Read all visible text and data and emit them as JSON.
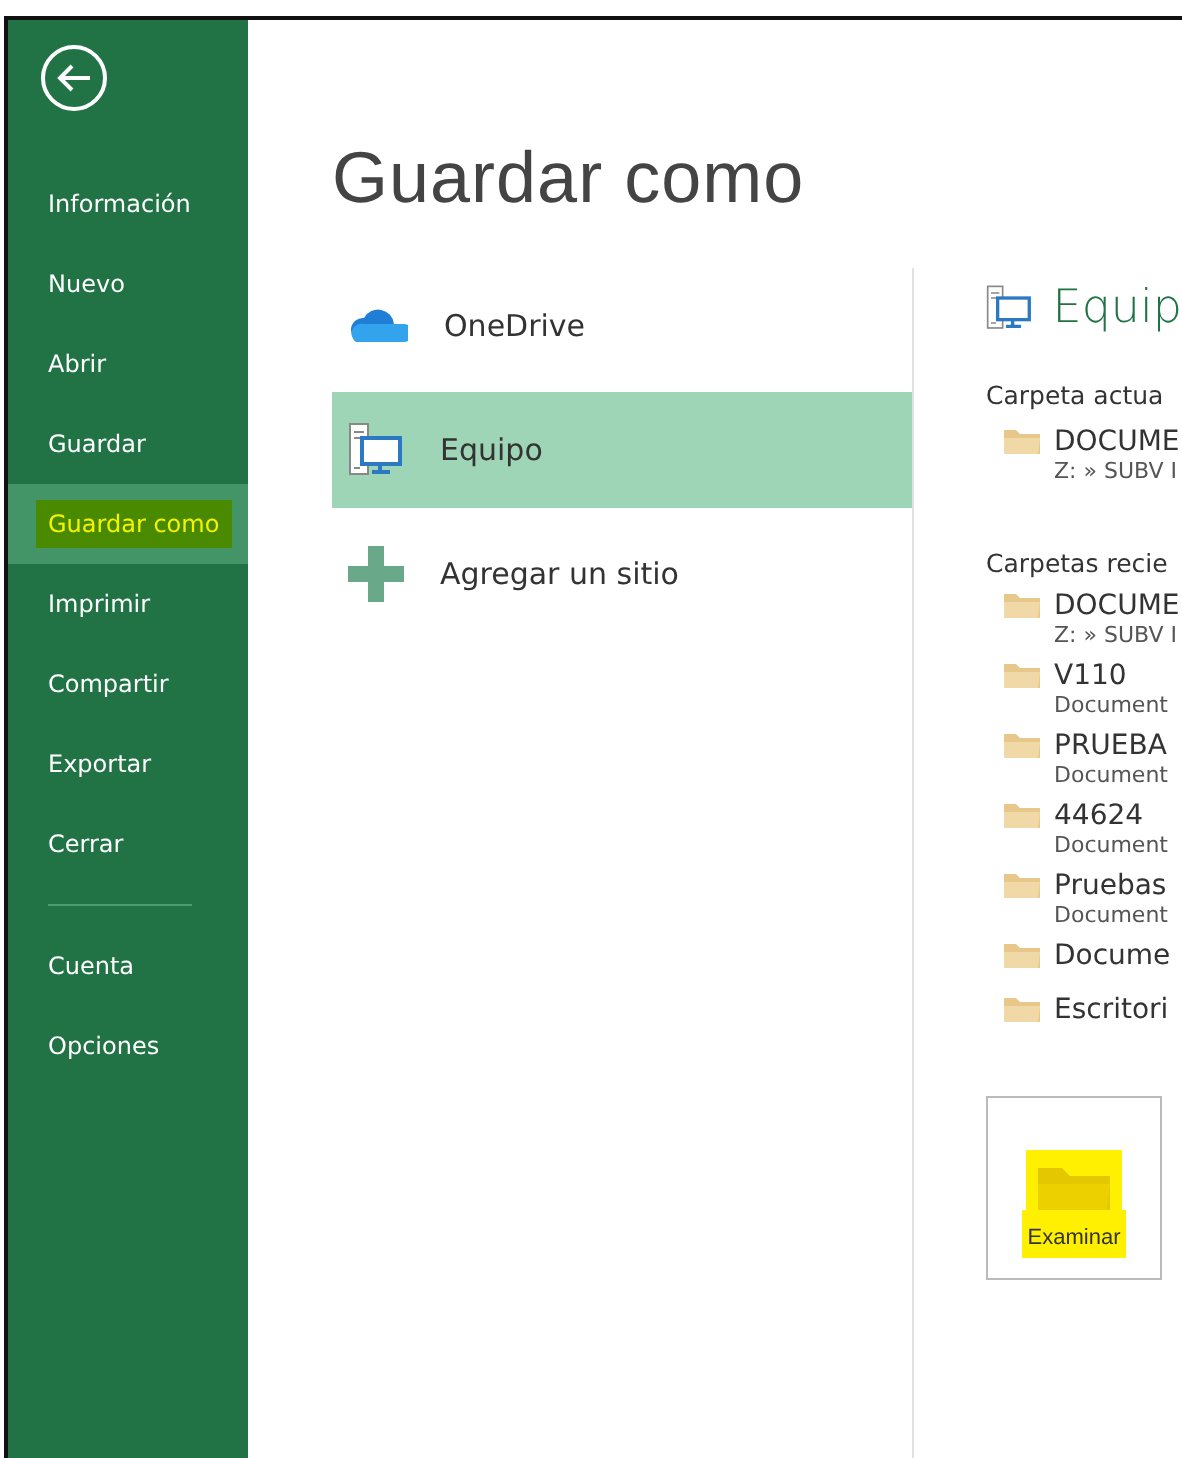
{
  "sidebar": {
    "items": [
      {
        "label": "Información",
        "selected": false,
        "highlighted": false,
        "kind": "item"
      },
      {
        "label": "Nuevo",
        "selected": false,
        "highlighted": false,
        "kind": "item"
      },
      {
        "label": "Abrir",
        "selected": false,
        "highlighted": false,
        "kind": "item"
      },
      {
        "label": "Guardar",
        "selected": false,
        "highlighted": false,
        "kind": "item"
      },
      {
        "label": "Guardar como",
        "selected": true,
        "highlighted": true,
        "kind": "item"
      },
      {
        "label": "Imprimir",
        "selected": false,
        "highlighted": false,
        "kind": "item"
      },
      {
        "label": "Compartir",
        "selected": false,
        "highlighted": false,
        "kind": "item"
      },
      {
        "label": "Exportar",
        "selected": false,
        "highlighted": false,
        "kind": "item"
      },
      {
        "label": "Cerrar",
        "selected": false,
        "highlighted": false,
        "kind": "item"
      },
      {
        "kind": "divider"
      },
      {
        "label": "Cuenta",
        "selected": false,
        "highlighted": false,
        "kind": "item"
      },
      {
        "label": "Opciones",
        "selected": false,
        "highlighted": false,
        "kind": "item"
      }
    ]
  },
  "page_title": "Guardar como",
  "places": [
    {
      "label": "OneDrive",
      "kind": "cloud",
      "selected": false
    },
    {
      "label": "Equipo",
      "kind": "computer",
      "selected": true
    },
    {
      "label": "Agregar un sitio",
      "kind": "add",
      "selected": false
    }
  ],
  "detail": {
    "title": "Equip",
    "current_heading": "Carpeta actua",
    "current": [
      {
        "name": "DOCUME",
        "path": "Z: » SUBV I"
      }
    ],
    "recent_heading": "Carpetas recie",
    "recent": [
      {
        "name": "DOCUME",
        "path": "Z: » SUBV I"
      },
      {
        "name": "V110",
        "path": "Document"
      },
      {
        "name": "PRUEBA",
        "path": "Document"
      },
      {
        "name": "44624",
        "path": "Document"
      },
      {
        "name": "Pruebas",
        "path": "Document"
      },
      {
        "name": "Docume"
      },
      {
        "name": "Escritori"
      }
    ],
    "browse": {
      "label": "Examinar",
      "highlighted": true
    }
  }
}
